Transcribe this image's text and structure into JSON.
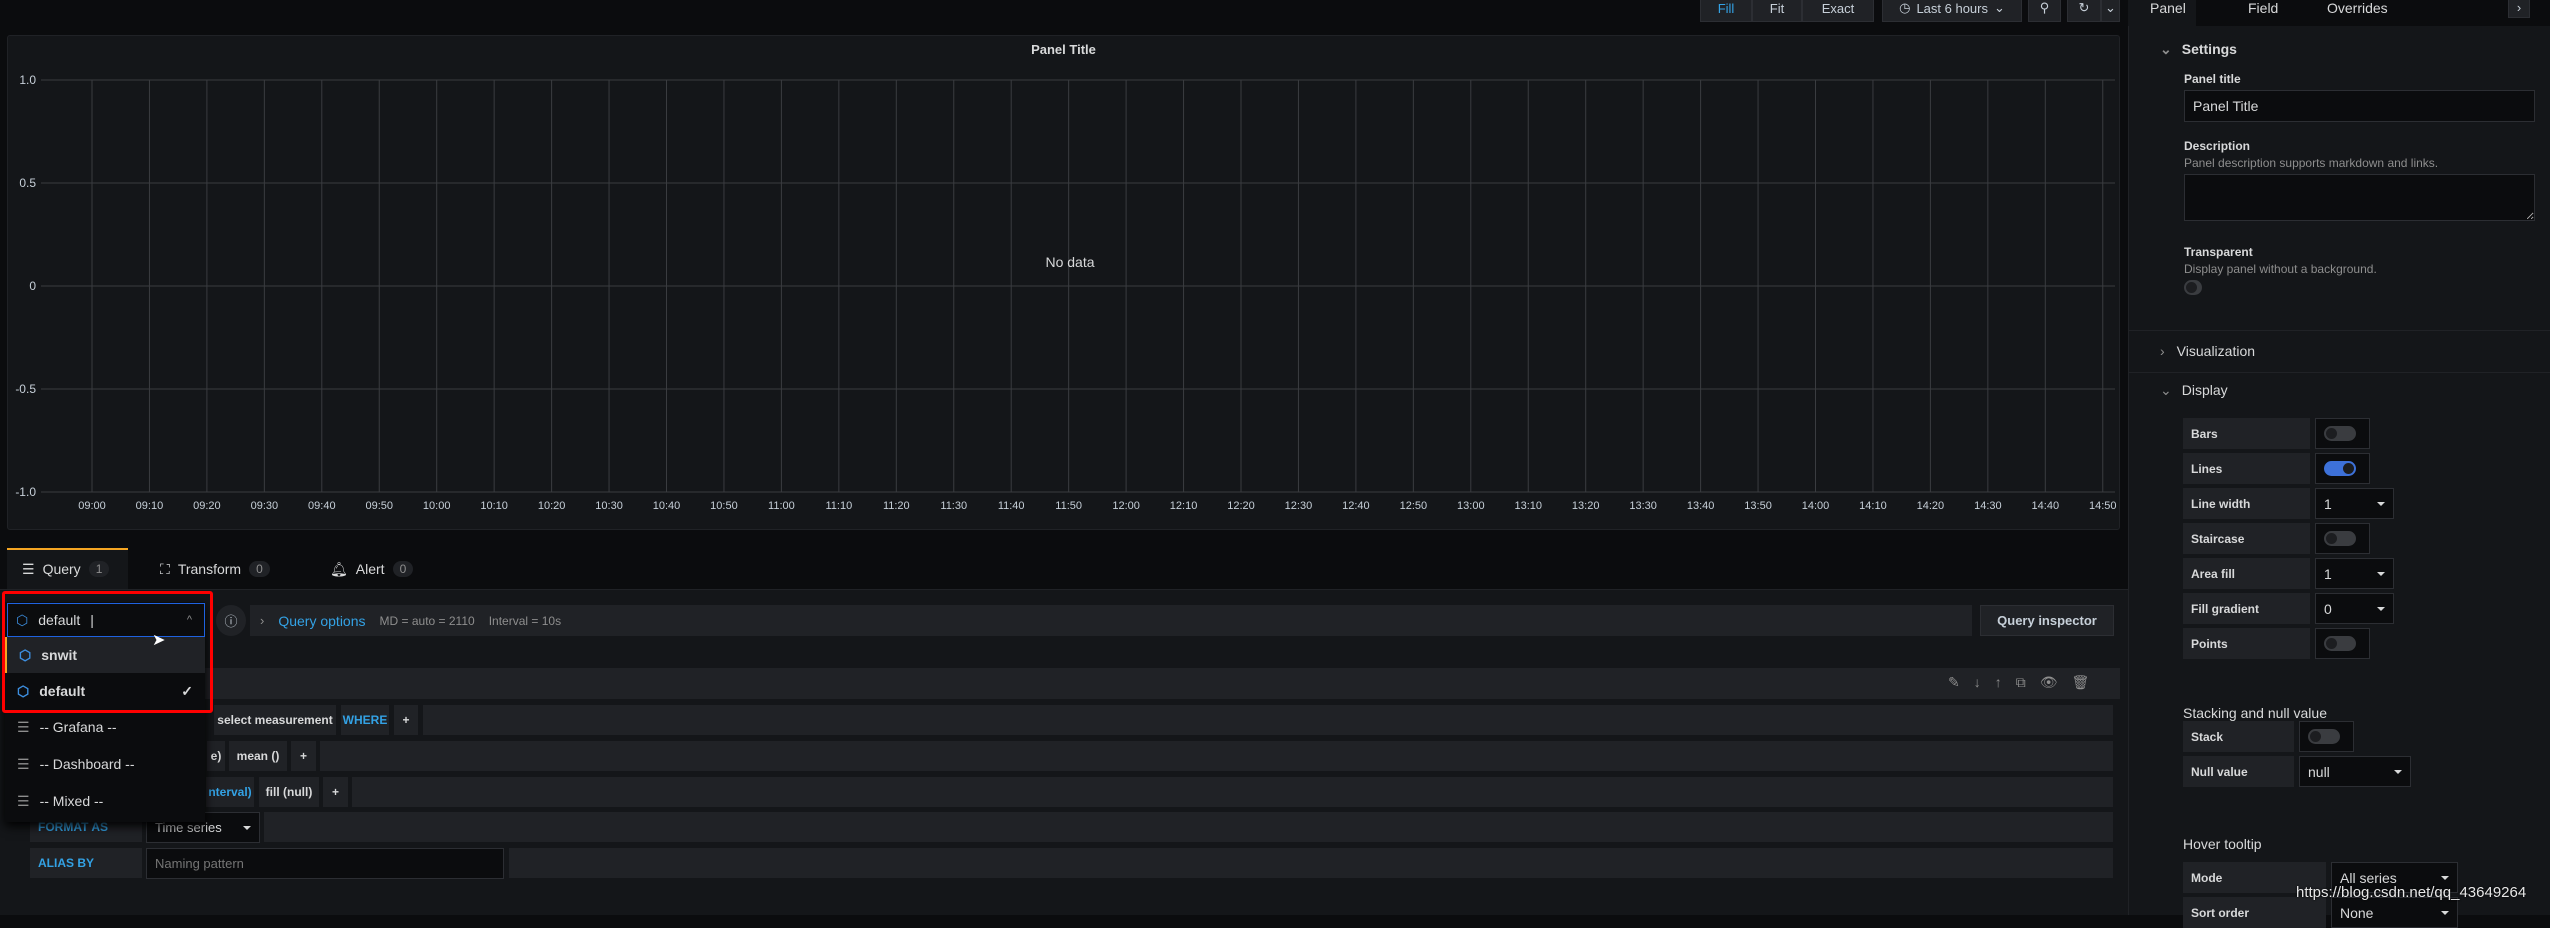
{
  "toolbar": {
    "fill": "Fill",
    "fit": "Fit",
    "exact": "Exact",
    "time_range": "Last 6 hours",
    "icons": [
      "clock-icon",
      "zoom-out-icon",
      "refresh-icon",
      "chevron-down-icon"
    ]
  },
  "panel": {
    "title": "Panel Title",
    "no_data": "No data"
  },
  "chart_data": {
    "type": "line",
    "title": "Panel Title",
    "series": [],
    "ylim": [
      -1,
      1
    ],
    "yticks": [
      "1.0",
      "0.5",
      "0",
      "-0.5",
      "-1.0"
    ],
    "xticks": [
      "09:00",
      "09:10",
      "09:20",
      "09:30",
      "09:40",
      "09:50",
      "10:00",
      "10:10",
      "10:20",
      "10:30",
      "10:40",
      "10:50",
      "11:00",
      "11:10",
      "11:20",
      "11:30",
      "11:40",
      "11:50",
      "12:00",
      "12:10",
      "12:20",
      "12:30",
      "12:40",
      "12:50",
      "13:00",
      "13:10",
      "13:20",
      "13:30",
      "13:40",
      "13:50",
      "14:00",
      "14:10",
      "14:20",
      "14:30",
      "14:40",
      "14:50"
    ],
    "grid": true,
    "annotation": "No data"
  },
  "tabs": [
    {
      "label": "Query",
      "count": "1"
    },
    {
      "label": "Transform",
      "count": "0"
    },
    {
      "label": "Alert",
      "count": "0"
    }
  ],
  "query": {
    "datasource_value": "default",
    "query_options": "Query options",
    "md": "MD = auto = 2110",
    "interval": "Interval = 10s",
    "inspector": "Query inspector",
    "from_measurement": "select measurement",
    "where": "WHERE",
    "select_tail": "e)",
    "select_fn": "mean ()",
    "group_tail": "nterval)",
    "group_fill": "fill (null)",
    "plus": "+",
    "format_label": "FORMAT AS",
    "format_value": "Time series",
    "alias_label": "ALIAS BY",
    "alias_placeholder": "Naming pattern"
  },
  "dropdown": {
    "items": [
      {
        "label": "snwit",
        "icon": "influxdb-icon"
      },
      {
        "label": "default",
        "icon": "influxdb-icon",
        "selected": true
      },
      {
        "label": "-- Grafana --",
        "icon": "database-icon"
      },
      {
        "label": "-- Dashboard --",
        "icon": "database-icon"
      },
      {
        "label": "-- Mixed --",
        "icon": "database-icon"
      }
    ]
  },
  "sidebar": {
    "tabs": [
      "Panel",
      "Field",
      "Overrides"
    ],
    "settings": {
      "header": "Settings",
      "panel_title_label": "Panel title",
      "panel_title_value": "Panel Title",
      "description_label": "Description",
      "description_help": "Panel description supports markdown and links.",
      "transparent_label": "Transparent",
      "transparent_help": "Display panel without a background.",
      "transparent": false
    },
    "visualization": "Visualization",
    "display": {
      "header": "Display",
      "bars": "Bars",
      "bars_on": false,
      "lines": "Lines",
      "lines_on": true,
      "line_width": "Line width",
      "line_width_value": "1",
      "staircase": "Staircase",
      "staircase_on": false,
      "area_fill": "Area fill",
      "area_fill_value": "1",
      "fill_gradient": "Fill gradient",
      "fill_gradient_value": "0",
      "points": "Points",
      "points_on": false
    },
    "stacking": {
      "header": "Stacking and null value",
      "stack": "Stack",
      "stack_on": false,
      "null_value": "Null value",
      "null_value_value": "null"
    },
    "tooltip": {
      "header": "Hover tooltip",
      "mode": "Mode",
      "mode_value": "All series",
      "sort": "Sort order",
      "sort_value": "None"
    }
  },
  "watermark": "https://blog.csdn.net/qq_43649264",
  "colors": {
    "accent": "#33a2e5",
    "highlight": "#ff0000",
    "toggle_on": "#3d71d9"
  }
}
